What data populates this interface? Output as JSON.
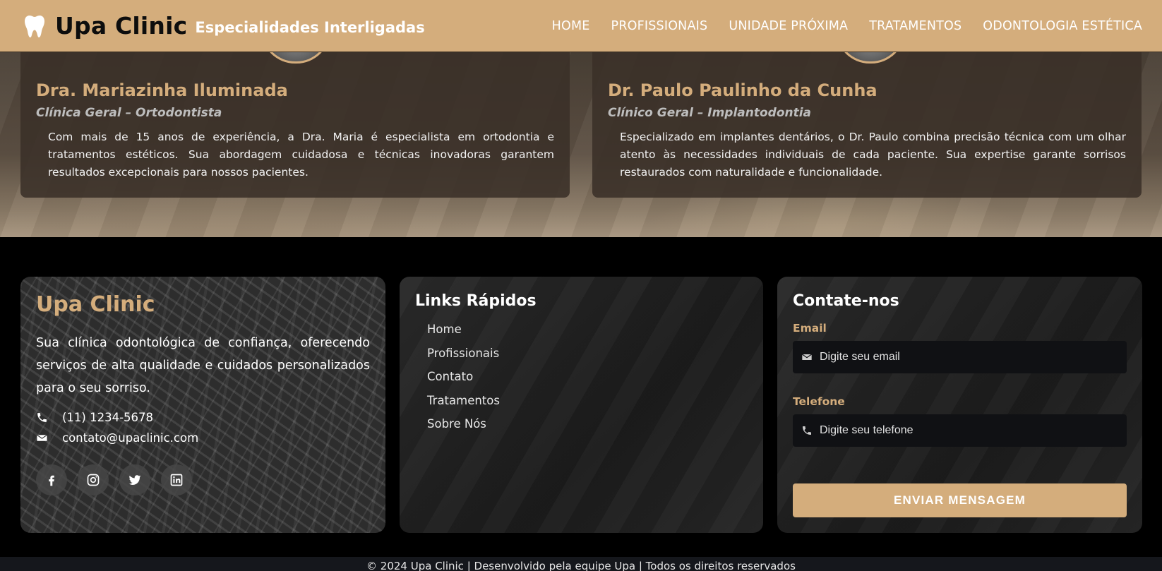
{
  "header": {
    "brand_name": "Upa Clinic",
    "tagline": "Especialidades Interligadas",
    "nav": [
      {
        "label": "HOME"
      },
      {
        "label": "PROFISSIONAIS"
      },
      {
        "label": "UNIDADE PRÓXIMA"
      },
      {
        "label": "TRATAMENTOS"
      },
      {
        "label": "ODONTOLOGIA ESTÉTICA"
      }
    ]
  },
  "professionals": [
    {
      "name": "Dra. Mariazinha Iluminada",
      "role": "Clínica Geral – Ortodontista",
      "description": "Com mais de 15 anos de experiência, a Dra. Maria é especialista em ortodontia e tratamentos estéticos. Sua abordagem cuidadosa e técnicas inovadoras garantem resultados excepcionais para nossos pacientes."
    },
    {
      "name": "Dr. Paulo Paulinho da Cunha",
      "role": "Clínico Geral – Implantodontia",
      "description": "Especializado em implantes dentários, o Dr. Paulo combina precisão técnica com um olhar atento às necessidades individuais de cada paciente. Sua expertise garante sorrisos restaurados com naturalidade e funcionalidade."
    }
  ],
  "footer": {
    "about": {
      "title": "Upa Clinic",
      "text": "Sua clínica odontológica de confiança, oferecendo serviços de alta qualidade e cuidados personalizados para o seu sorriso.",
      "phone": "(11) 1234-5678",
      "email": "contato@upaclinic.com",
      "socials": [
        "facebook-icon",
        "instagram-icon",
        "twitter-icon",
        "linkedin-icon"
      ]
    },
    "links": {
      "title": "Links Rápidos",
      "items": [
        {
          "label": "Home"
        },
        {
          "label": "Profissionais"
        },
        {
          "label": "Contato"
        },
        {
          "label": "Tratamentos"
        },
        {
          "label": "Sobre Nós"
        }
      ]
    },
    "contact": {
      "title": "Contate-nos",
      "email_label": "Email",
      "email_placeholder": "Digite seu email",
      "phone_label": "Telefone",
      "phone_placeholder": "Digite seu telefone",
      "submit_label": "ENVIAR MENSAGEM"
    },
    "copyright": "© 2024 Upa Clinic | Desenvolvido pela equipe Upa | Todos os direitos reservados"
  },
  "colors": {
    "accent": "#d4ad7c",
    "footer_bg": "#000000",
    "card_bg": "#3a3028"
  }
}
